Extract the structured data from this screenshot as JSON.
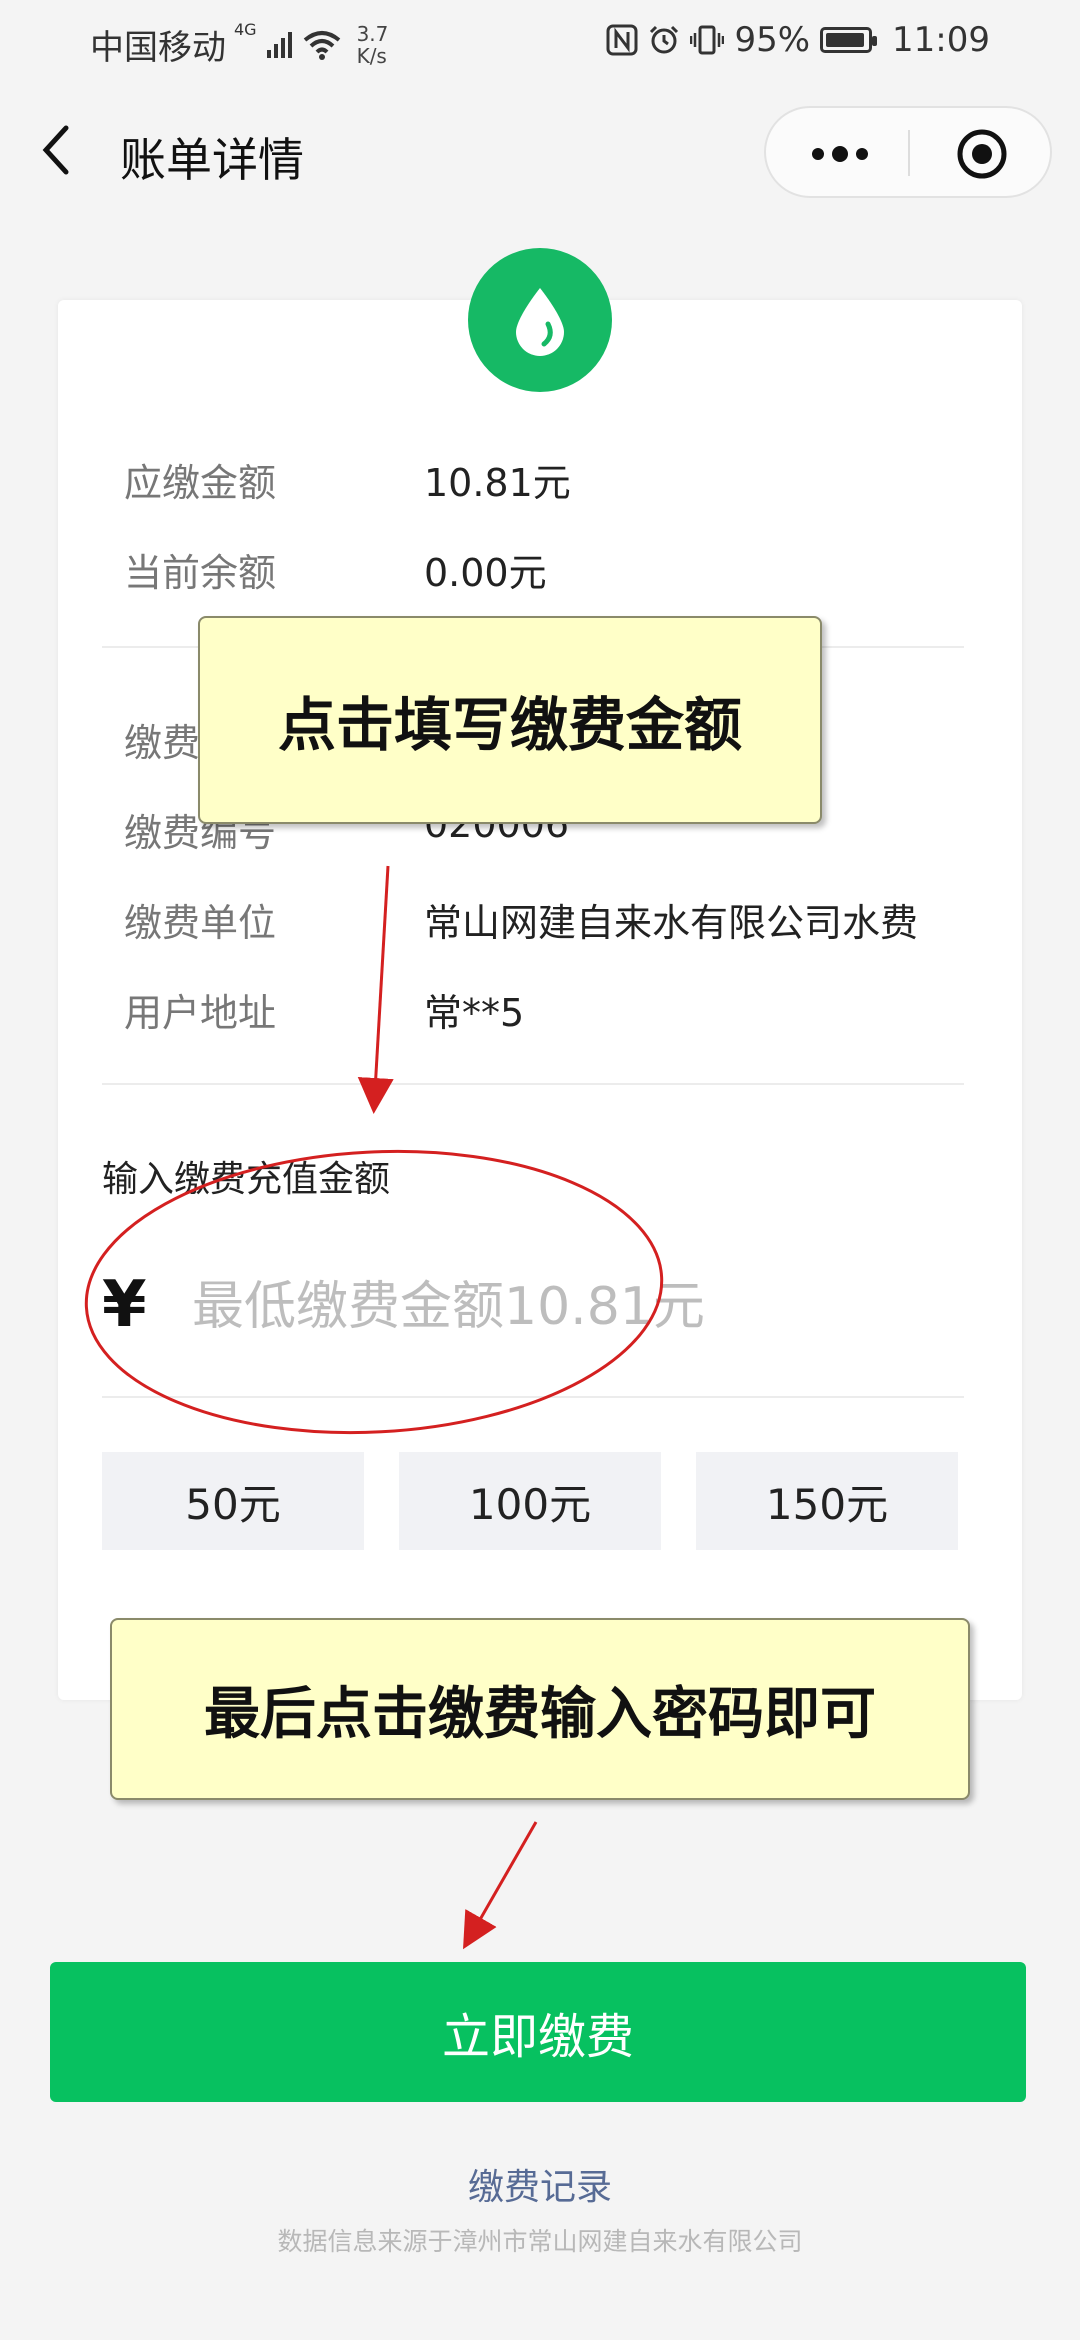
{
  "status_bar": {
    "carrier": "中国移动",
    "network": "4G",
    "speed_value": "3.7",
    "speed_unit": "K/s",
    "battery": "95%",
    "time": "11:09"
  },
  "nav": {
    "title": "账单详情"
  },
  "bill": {
    "due": {
      "label": "应缴金额",
      "value": "10.81元"
    },
    "balance": {
      "label": "当前余额",
      "value": "0.00元"
    },
    "payer": {
      "label": "缴费"
    },
    "number": {
      "label": "缴费编号",
      "value": "020006"
    },
    "unit": {
      "label": "缴费单位",
      "value": "常山网建自来水有限公司水费"
    },
    "address": {
      "label": "用户地址",
      "value": "常**5"
    }
  },
  "recharge": {
    "label": "输入缴费充值金额",
    "currency_symbol": "¥",
    "placeholder": "最低缴费金额10.81元",
    "presets": [
      "50元",
      "100元",
      "150元"
    ]
  },
  "annotations": {
    "note1": "点击填写缴费金额",
    "note2": "最后点击缴费输入密码即可"
  },
  "actions": {
    "pay_label": "立即缴费",
    "records_label": "缴费记录"
  },
  "footer": {
    "source": "数据信息来源于漳州市常山网建自来水有限公司"
  },
  "colors": {
    "primary_green": "#07c160",
    "badge_green": "#16b965",
    "link_blue": "#576b95",
    "annotation_red": "#d42020",
    "note_bg": "#ffffc8"
  }
}
